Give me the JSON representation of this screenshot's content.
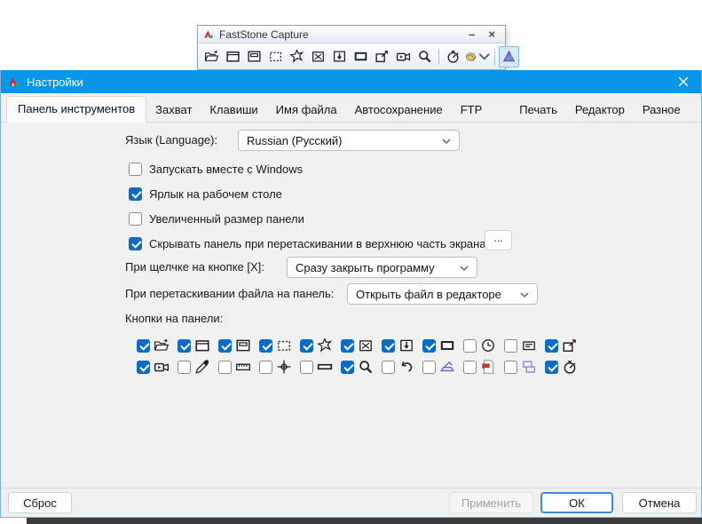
{
  "toolbar_window": {
    "title": "FastStone Capture",
    "minimize_glyph": "–",
    "close_glyph": "×",
    "icons": [
      "open-file",
      "capture-window",
      "capture-active-window",
      "capture-rectangle",
      "capture-freehand",
      "capture-fullscreen",
      "capture-scrolling",
      "capture-fixed-region",
      "annotate",
      "screen-recorder",
      "magnifier",
      "delay-stopwatch",
      "draw-palette",
      "faststone-settings"
    ]
  },
  "dialog": {
    "title": "Настройки",
    "close_icon": "close-icon",
    "tabs": [
      {
        "label": "Панель инструментов",
        "selected": true
      },
      {
        "label": "Захват",
        "selected": false
      },
      {
        "label": "Клавиши",
        "selected": false
      },
      {
        "label": "Имя файла",
        "selected": false
      },
      {
        "label": "Автосохранение",
        "selected": false
      },
      {
        "label": "FTP",
        "selected": false
      },
      {
        "label": "Печать",
        "selected": false
      },
      {
        "label": "Редактор",
        "selected": false
      },
      {
        "label": "Разное",
        "selected": false
      }
    ],
    "language": {
      "label": "Язык (Language):",
      "value": "Russian (Русский)"
    },
    "options": [
      {
        "label": "Запускать вместе с Windows",
        "checked": false
      },
      {
        "label": "Ярлык на рабочем столе",
        "checked": true
      },
      {
        "label": "Увеличенный размер панели",
        "checked": false
      },
      {
        "label": "Скрывать панель при перетаскивании в верхнюю часть экрана",
        "checked": true
      }
    ],
    "more_button_label": "...",
    "on_close": {
      "label": "При щелчке на кнопке [X]:",
      "value": "Сразу закрыть программу"
    },
    "on_drag": {
      "label": "При перетаскивании файла на панель:",
      "value": "Открыть файл в редакторе"
    },
    "panel_buttons_label": "Кнопки на панели:",
    "panel_buttons": {
      "row1": [
        {
          "icon": "open-file",
          "checked": true
        },
        {
          "icon": "capture-window",
          "checked": true
        },
        {
          "icon": "capture-active-window",
          "checked": true
        },
        {
          "icon": "capture-rectangle",
          "checked": true
        },
        {
          "icon": "capture-freehand",
          "checked": true
        },
        {
          "icon": "capture-fullscreen",
          "checked": true
        },
        {
          "icon": "capture-scrolling",
          "checked": true
        },
        {
          "icon": "capture-fixed-region",
          "checked": true
        },
        {
          "icon": "delay-clock",
          "checked": false
        },
        {
          "icon": "capture-object",
          "checked": false
        },
        {
          "icon": "annotate",
          "checked": true
        }
      ],
      "row2": [
        {
          "icon": "screen-recorder",
          "checked": true
        },
        {
          "icon": "color-picker",
          "checked": false
        },
        {
          "icon": "ruler",
          "checked": false
        },
        {
          "icon": "crosshair",
          "checked": false
        },
        {
          "icon": "screen-bar",
          "checked": false
        },
        {
          "icon": "magnifier",
          "checked": true
        },
        {
          "icon": "undo",
          "checked": false
        },
        {
          "icon": "scanner",
          "checked": false
        },
        {
          "icon": "pdf",
          "checked": false
        },
        {
          "icon": "join-images",
          "checked": false
        },
        {
          "icon": "stopwatch",
          "checked": true
        }
      ]
    },
    "footer": {
      "reset": "Сброс",
      "apply": "Применить",
      "ok": "ОК",
      "cancel": "Отмена"
    },
    "colors": {
      "titlebar": "#0897e8",
      "accent_check": "#0e6bc2",
      "ok_border": "#3f87d1"
    }
  }
}
